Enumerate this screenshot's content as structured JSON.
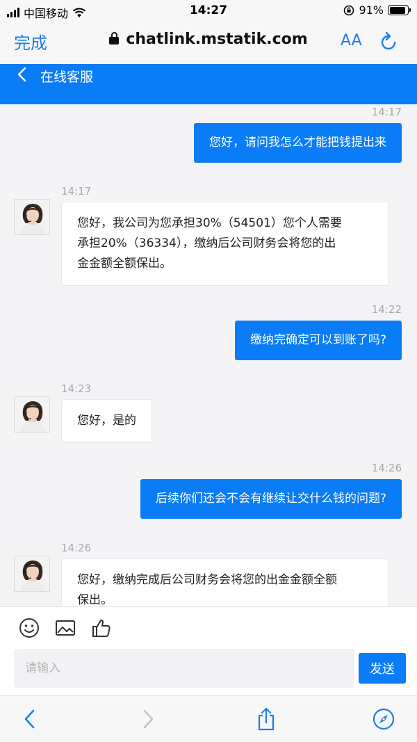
{
  "status_bar": {
    "carrier": "中国移动",
    "time": "14:27",
    "battery": "91%",
    "battery_level": 0.91
  },
  "browser": {
    "done_label": "完成",
    "url": "chatlink.mstatik.com",
    "text_size_label": "AA"
  },
  "header": {
    "title": "在线客服"
  },
  "messages": [
    {
      "side": "out",
      "time": "14:17",
      "text": "您好，请问我怎么才能把钱提出来"
    },
    {
      "side": "in",
      "time": "14:17",
      "lines": [
        "您好，我公司为您承担30%（54501）您个人需要",
        "承担20%（36334），缴纳后公司财务会将您的出",
        "金金额全额保出。"
      ]
    },
    {
      "side": "out",
      "time": "14:22",
      "text": "缴纳完确定可以到账了吗?"
    },
    {
      "side": "in",
      "time": "14:23",
      "lines": [
        "您好，是的"
      ]
    },
    {
      "side": "out",
      "time": "14:26",
      "text": "后续你们还会不会有继续让交什么钱的问题?"
    },
    {
      "side": "in",
      "time": "14:26",
      "lines": [
        "您好，缴纳完成后公司财务会将您的出金金额全额",
        "保出。"
      ]
    }
  ],
  "composer": {
    "placeholder": "请输入",
    "send_label": "发送"
  },
  "icons": {
    "emoji": "emoji-icon",
    "image": "image-icon",
    "like": "thumbs-up-icon",
    "back": "chevron-left-icon",
    "forward": "chevron-right-icon",
    "share": "share-icon",
    "compass": "compass-icon"
  },
  "colors": {
    "accent": "#0a7cf5",
    "link": "#1a7cf0",
    "timestamp": "#a7a7ab"
  }
}
